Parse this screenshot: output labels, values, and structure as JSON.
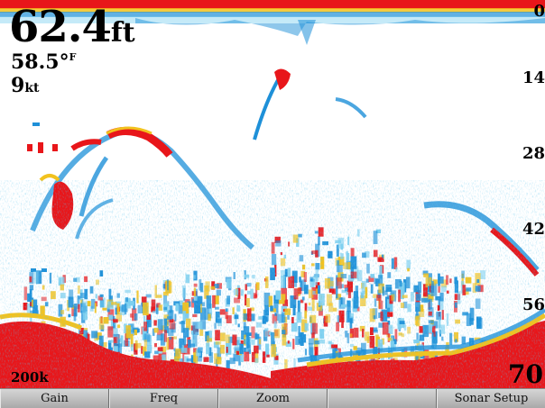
{
  "readouts": {
    "depth_value": "62.4",
    "depth_unit": "ft",
    "temp_value": "58.5°",
    "temp_unit": "F",
    "speed_value": "9",
    "speed_unit": "kt"
  },
  "depth_scale": [
    "0",
    "14",
    "28",
    "42",
    "56"
  ],
  "range_bottom": "70",
  "frequency": "200k",
  "softkeys": [
    {
      "label": "Gain"
    },
    {
      "label": "Freq"
    },
    {
      "label": "Zoom"
    },
    {
      "label": ""
    },
    {
      "label": "Sonar Setup"
    }
  ],
  "colors": {
    "strong": "#e8161a",
    "medium": "#f2c21e",
    "weak": "#1e90d8",
    "faint": "#7fd0ef",
    "background": "#ffffff"
  }
}
